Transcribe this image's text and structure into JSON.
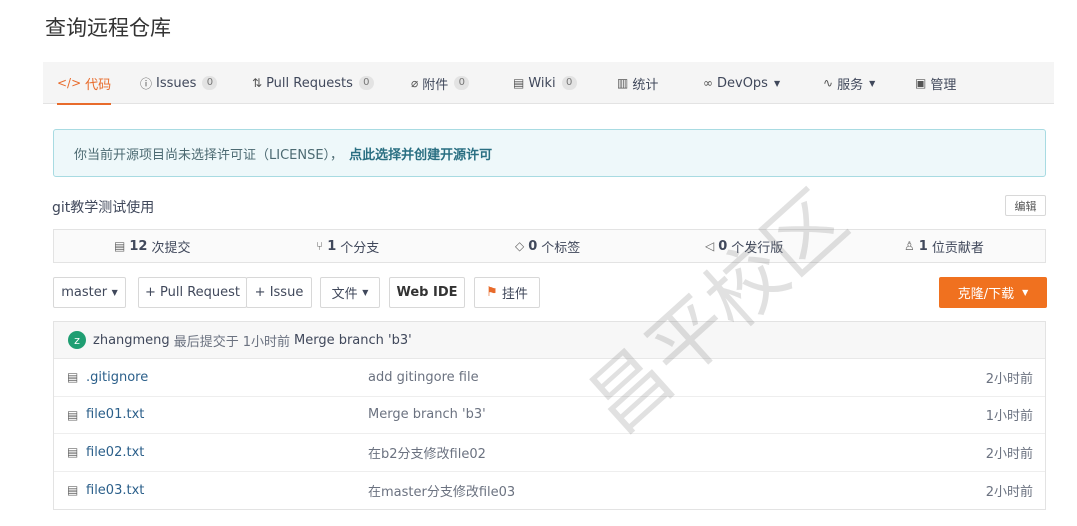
{
  "page": {
    "title": "查询远程仓库"
  },
  "tabs": [
    {
      "icon": "code-icon",
      "glyph": "</>",
      "label": "代码",
      "active": true
    },
    {
      "icon": "issues-icon",
      "glyph": "ⓘ",
      "label": "Issues",
      "badge": "0"
    },
    {
      "icon": "pull-request-icon",
      "glyph": "⇅",
      "label": "Pull Requests",
      "badge": "0"
    },
    {
      "icon": "attachment-icon",
      "glyph": "⌀",
      "label": "附件",
      "badge": "0"
    },
    {
      "icon": "wiki-icon",
      "glyph": "▤",
      "label": "Wiki",
      "badge": "0"
    },
    {
      "icon": "stats-icon",
      "glyph": "▥",
      "label": "统计"
    },
    {
      "icon": "devops-icon",
      "glyph": "∞",
      "label": "DevOps",
      "dropdown": true
    },
    {
      "icon": "service-icon",
      "glyph": "∿",
      "label": "服务",
      "dropdown": true
    },
    {
      "icon": "manage-icon",
      "glyph": "▣",
      "label": "管理"
    }
  ],
  "banner": {
    "text": "你当前开源项目尚未选择许可证（LICENSE），",
    "link": "点此选择并创建开源许可"
  },
  "repo": {
    "description": "git教学测试使用",
    "edit_label": "编辑"
  },
  "stats": [
    {
      "icon": "commit-icon",
      "glyph": "▤",
      "count": "12",
      "label": "次提交"
    },
    {
      "icon": "branch-icon",
      "glyph": "⑂",
      "count": "1",
      "label": "个分支"
    },
    {
      "icon": "tag-icon",
      "glyph": "◇",
      "count": "0",
      "label": "个标签"
    },
    {
      "icon": "release-icon",
      "glyph": "◁",
      "count": "0",
      "label": "个发行版"
    },
    {
      "icon": "contributor-icon",
      "glyph": "♙",
      "count": "1",
      "label": "位贡献者"
    }
  ],
  "toolbar": {
    "branch": "master",
    "pull_request": "+ Pull Request",
    "issue": "+ Issue",
    "file": "文件",
    "web_ide": "Web IDE",
    "widget": "挂件",
    "clone": "克隆/下载"
  },
  "last_commit": {
    "avatar_letter": "z",
    "author": "zhangmeng",
    "prefix": "最后提交于",
    "time": "1小时前",
    "message": "Merge branch 'b3'"
  },
  "files": [
    {
      "name": ".gitignore",
      "message": "add gitingore file",
      "time": "2小时前"
    },
    {
      "name": "file01.txt",
      "message": "Merge branch 'b3'",
      "time": "1小时前"
    },
    {
      "name": "file02.txt",
      "message": "在b2分支修改file02",
      "time": "2小时前"
    },
    {
      "name": "file03.txt",
      "message": "在master分支修改file03",
      "time": "2小时前"
    }
  ],
  "watermark": "昌平校区"
}
